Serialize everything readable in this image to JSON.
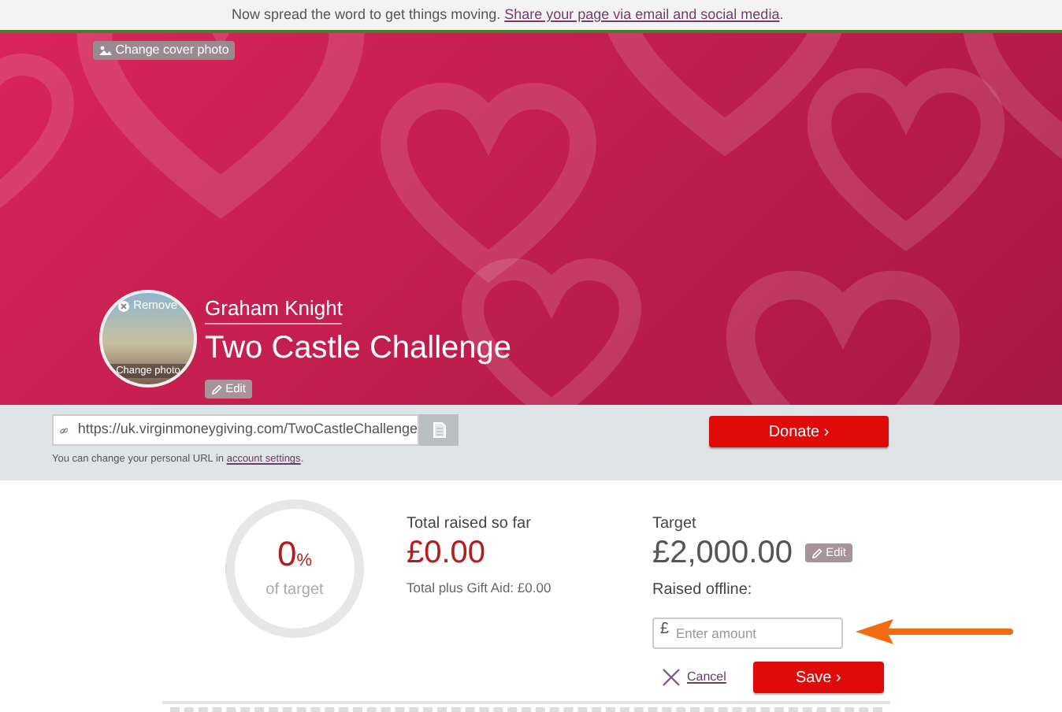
{
  "notice": {
    "text": "Now spread the word to get things moving.",
    "link": "Share your page via email and social media",
    "end": "."
  },
  "cover": {
    "change_cover_button": "Change cover photo",
    "avatar": {
      "remove_label": "Remove",
      "change_label": "Change photo"
    },
    "fundraiser_name": "Graham Knight",
    "page_title": "Two Castle Challenge",
    "edit_button": "Edit"
  },
  "url_bar": {
    "url": "https://uk.virginmoneygiving.com/TwoCastleChallenge",
    "hint": "You can change your personal URL in",
    "hint_link": "account settings",
    "hint_end": ".",
    "donate_button": "Donate ›"
  },
  "progress": {
    "level": 0,
    "percent": "0",
    "percent_sign": "%",
    "caption": "of target"
  },
  "totals": {
    "label": "Total raised so far",
    "amount": "£0.00",
    "gift_aid": "Total plus Gift Aid: £0.00"
  },
  "target": {
    "label": "Target",
    "amount": "£2,000.00",
    "edit_button": "Edit",
    "offline_label": "Raised offline:",
    "currency": "£",
    "placeholder": "Enter amount",
    "cancel": "Cancel",
    "save": "Save ›"
  }
}
